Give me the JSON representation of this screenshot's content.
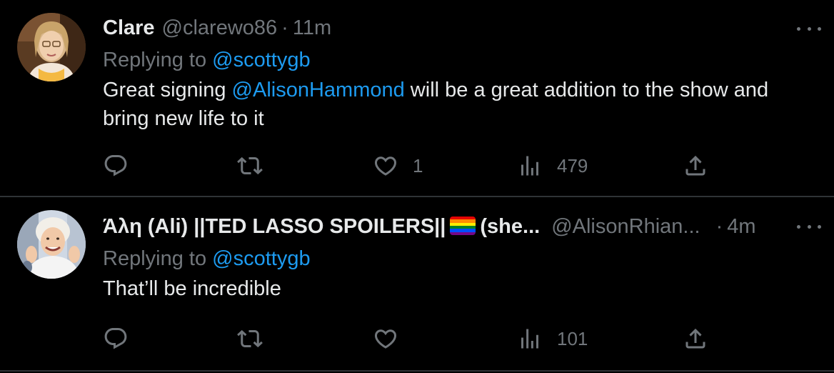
{
  "tweets": [
    {
      "display_name": "Clare",
      "handle": "@clarewo86",
      "separator": "·",
      "time": "11m",
      "replying_prefix": "Replying to",
      "replying_to": "@scottygb",
      "text_before": "Great signing ",
      "text_mention": "@AlisonHammond",
      "text_after": " will be a great addition to the show and bring new life to it",
      "reply_count": "",
      "retweet_count": "",
      "like_count": "1",
      "view_count": "479"
    },
    {
      "display_name_part1": "Άλη (Ali) ||TED LASSO SPOILERS||",
      "display_name_part2": "(she...",
      "handle": "@AlisonRhian...",
      "separator": "·",
      "time": "4m",
      "replying_prefix": "Replying to",
      "replying_to": "@scottygb",
      "text": "That’ll be incredible",
      "reply_count": "",
      "retweet_count": "",
      "like_count": "",
      "view_count": "101"
    }
  ],
  "icons": {
    "reply": "reply-icon",
    "retweet": "retweet-icon",
    "like": "like-icon",
    "views": "views-icon",
    "share": "share-icon",
    "more": "more-icon",
    "flag": "rainbow-flag-icon"
  },
  "colors": {
    "background": "#000000",
    "text": "#e7e9ea",
    "secondary": "#71767b",
    "link": "#1d9bf0",
    "divider": "#2f3336"
  }
}
